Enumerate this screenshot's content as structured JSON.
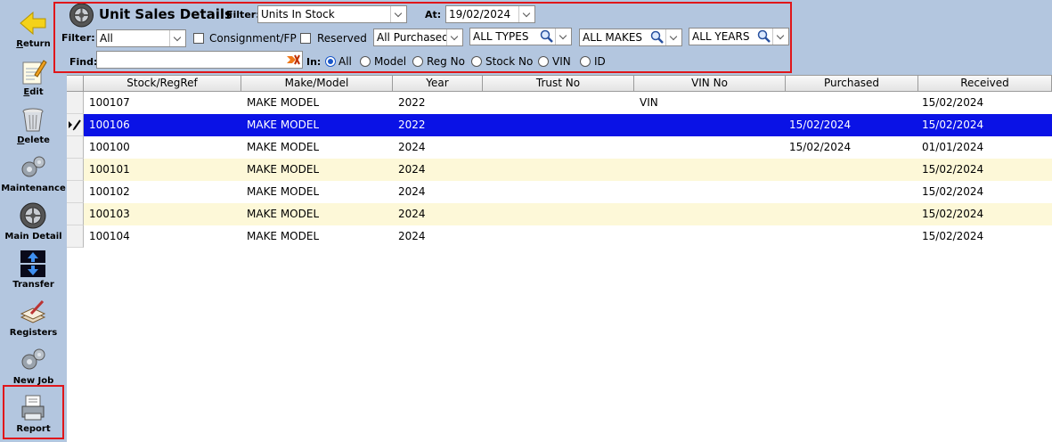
{
  "sidebar": {
    "items": [
      {
        "label": "Return",
        "underline": "R",
        "rest": "eturn",
        "icon": "arrow-left-icon"
      },
      {
        "label": "Edit",
        "underline": "E",
        "rest": "dit",
        "icon": "notepad-pencil-icon"
      },
      {
        "label": "Delete",
        "underline": "D",
        "rest": "elete",
        "icon": "trash-can-icon"
      },
      {
        "label": "Maintenance",
        "underline": "",
        "rest": "Maintenance",
        "icon": "gears-icon"
      },
      {
        "label": "Main Detail",
        "underline": "",
        "rest": "Main Detail",
        "icon": "wheel-icon"
      },
      {
        "label": "Transfer",
        "underline": "",
        "rest": "Transfer",
        "icon": "transfer-arrows-icon"
      },
      {
        "label": "Registers",
        "underline": "",
        "rest": "Registers",
        "icon": "book-pen-icon"
      },
      {
        "label": "New Job",
        "underline": "",
        "rest": "New Job",
        "icon": "gears-icon"
      },
      {
        "label": "Report",
        "underline": "",
        "rest": "Report",
        "icon": "printer-report-icon"
      }
    ]
  },
  "header": {
    "title": "Unit Sales Details",
    "filter_label": "Filter:",
    "filter_value": "Units In Stock",
    "at_label": "At:",
    "at_value": "19/02/2024",
    "filter2_label": "Filter:",
    "filter2_value": "All",
    "consignment_label": "Consignment/FP",
    "consignment_checked": false,
    "reserved_label": "Reserved",
    "reserved_checked": false,
    "purchased_value": "All Purchased",
    "types_value": "ALL TYPES",
    "makes_value": "ALL MAKES",
    "years_value": "ALL YEARS",
    "find_label": "Find:",
    "find_value": "",
    "in_label": "In:",
    "radios": [
      "All",
      "Model",
      "Reg No",
      "Stock No",
      "VIN",
      "ID"
    ],
    "radio_selected": "All"
  },
  "grid": {
    "columns": [
      "Stock/RegRef",
      "Make/Model",
      "Year",
      "Trust No",
      "VIN No",
      "Purchased",
      "Received"
    ],
    "rows": [
      {
        "stock": "100107",
        "model": "MAKE MODEL",
        "year": "2022",
        "trust": "",
        "vin": "VIN",
        "purchased": "",
        "received": "15/02/2024"
      },
      {
        "stock": "100106",
        "model": "MAKE MODEL",
        "year": "2022",
        "trust": "",
        "vin": "",
        "purchased": "15/02/2024",
        "received": "15/02/2024"
      },
      {
        "stock": "100100",
        "model": "MAKE MODEL",
        "year": "2024",
        "trust": "",
        "vin": "",
        "purchased": "15/02/2024",
        "received": "01/01/2024"
      },
      {
        "stock": "100101",
        "model": "MAKE MODEL",
        "year": "2024",
        "trust": "",
        "vin": "",
        "purchased": "",
        "received": "15/02/2024"
      },
      {
        "stock": "100102",
        "model": "MAKE MODEL",
        "year": "2024",
        "trust": "",
        "vin": "",
        "purchased": "",
        "received": "15/02/2024"
      },
      {
        "stock": "100103",
        "model": "MAKE MODEL",
        "year": "2024",
        "trust": "",
        "vin": "",
        "purchased": "",
        "received": "15/02/2024"
      },
      {
        "stock": "100104",
        "model": "MAKE MODEL",
        "year": "2024",
        "trust": "",
        "vin": "",
        "purchased": "",
        "received": "15/02/2024"
      }
    ],
    "selected_row": 1
  },
  "colors": {
    "toolbar_bg": "#b3c6df",
    "selection": "#0a12e6",
    "alt_row": "#fdf8d8",
    "highlight_border": "#e0161a"
  }
}
